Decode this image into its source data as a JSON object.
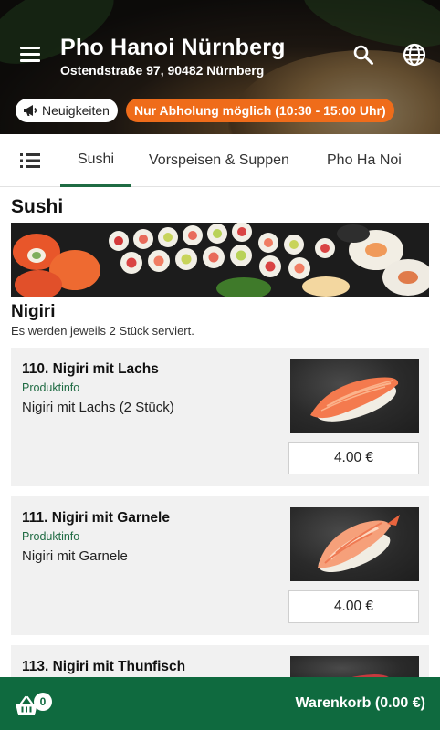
{
  "header": {
    "title": "Pho Hanoi Nürnberg",
    "address": "Ostendstraße 97, 90482 Nürnberg",
    "news_label": "Neuigkeiten",
    "pickup_label": "Nur Abholung möglich (10:30 - 15:00 Uhr)",
    "icons": [
      "menu-icon",
      "search-icon",
      "globe-icon",
      "megaphone-icon"
    ],
    "pickup_color": "#ef6c1a"
  },
  "tabs": {
    "items": [
      "Sushi",
      "Vorspeisen & Suppen",
      "Pho Ha Noi"
    ],
    "active": "Sushi",
    "accent": "#1f6b43"
  },
  "section": {
    "title": "Sushi",
    "subsection_title": "Nigiri",
    "subsection_desc": "Es werden jeweils 2 Stück serviert."
  },
  "products": [
    {
      "name": "110. Nigiri mit Lachs",
      "info": "Produktinfo",
      "desc": "Nigiri mit Lachs (2 Stück)",
      "price": "4.00 €"
    },
    {
      "name": "111. Nigiri mit Garnele",
      "info": "Produktinfo",
      "desc": "Nigiri mit Garnele",
      "price": "4.00 €"
    },
    {
      "name": "113. Nigiri mit Thunfisch"
    }
  ],
  "cart": {
    "count": "0",
    "label": "Warenkorb (0.00 €)",
    "color": "#0f6a3f"
  }
}
